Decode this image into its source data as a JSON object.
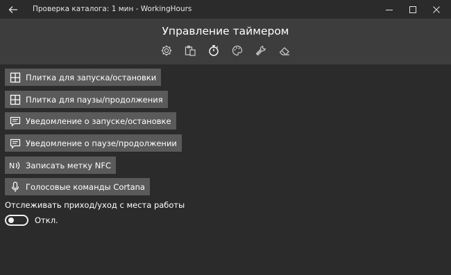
{
  "window": {
    "title": "Проверка каталога: 1 мин - WorkingHours"
  },
  "header": {
    "page_title": "Управление таймером",
    "toolbar_icons": [
      "settings-icon",
      "clipboard-icon",
      "timer-icon",
      "palette-icon",
      "wrench-icon",
      "eraser-icon"
    ]
  },
  "actions": [
    {
      "icon": "tile-icon",
      "label": "Плитка для запуска/остановки"
    },
    {
      "icon": "tile-icon",
      "label": "Плитка для паузы/продолжения"
    },
    {
      "icon": "notification-icon",
      "label": "Уведомление о запуске/остановке"
    },
    {
      "icon": "notification-icon",
      "label": "Уведомление о паузе/продолжении"
    },
    {
      "icon": "nfc-icon",
      "label": "Записать метку NFC"
    },
    {
      "icon": "microphone-icon",
      "label": "Голосовые команды Cortana"
    }
  ],
  "tracking": {
    "label": "Отслеживать приход/уход с места работы",
    "toggle_state": "Откл."
  },
  "colors": {
    "background": "#2b2b2b",
    "header": "#3d3d3d",
    "button": "#5a5a5a"
  }
}
